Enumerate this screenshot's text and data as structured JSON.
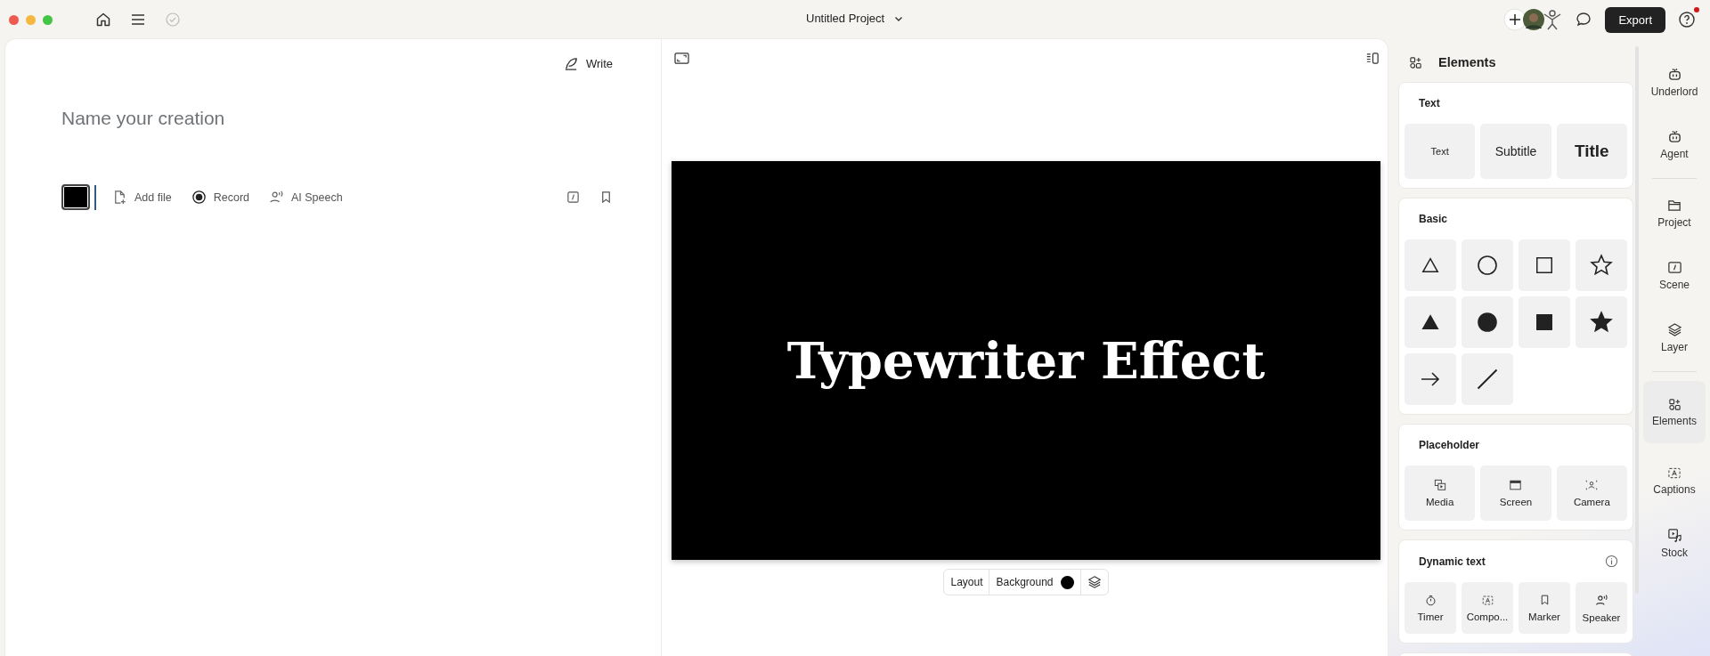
{
  "window": {
    "title": "Untitled Project"
  },
  "toolbar": {
    "export": "Export",
    "help_alert": true
  },
  "editor": {
    "write_button": "Write",
    "title_placeholder": "Name your creation",
    "actions": [
      {
        "label": "Add file",
        "kind": "file"
      },
      {
        "label": "Record",
        "kind": "record"
      },
      {
        "label": "AI Speech",
        "kind": "speech"
      }
    ]
  },
  "canvas": {
    "headline": "Typewriter Effect",
    "layout_button": "Layout",
    "background_button": "Background"
  },
  "elements_panel": {
    "title": "Elements",
    "sections": [
      {
        "title": "Text",
        "info": false,
        "items": [
          {
            "label": "Text",
            "kind": "plain"
          },
          {
            "label": "Subtitle",
            "kind": "subtitle"
          },
          {
            "label": "Title",
            "kind": "title"
          }
        ]
      },
      {
        "title": "Basic",
        "info": false,
        "items": [
          {
            "kind": "triangle",
            "filled": false
          },
          {
            "kind": "circle",
            "filled": false
          },
          {
            "kind": "square",
            "filled": false
          },
          {
            "kind": "star",
            "filled": false
          },
          {
            "kind": "triangle",
            "filled": true
          },
          {
            "kind": "circle",
            "filled": true
          },
          {
            "kind": "square",
            "filled": true
          },
          {
            "kind": "star",
            "filled": true
          },
          {
            "kind": "arrow"
          },
          {
            "kind": "line"
          }
        ]
      },
      {
        "title": "Placeholder",
        "info": false,
        "items": [
          {
            "label": "Media",
            "kind": "media"
          },
          {
            "label": "Screen",
            "kind": "screen"
          },
          {
            "label": "Camera",
            "kind": "camera"
          }
        ]
      },
      {
        "title": "Dynamic text",
        "info": true,
        "items": [
          {
            "label": "Timer",
            "kind": "timer"
          },
          {
            "label": "Compo...",
            "kind": "captions"
          },
          {
            "label": "Marker",
            "kind": "marker"
          },
          {
            "label": "Speaker",
            "kind": "speaker"
          }
        ]
      }
    ]
  },
  "rail": [
    {
      "items": [
        {
          "label": "Underlord",
          "kind": "robot",
          "selected": false
        },
        {
          "label": "Agent",
          "kind": "robot",
          "selected": false
        }
      ]
    },
    {
      "items": [
        {
          "label": "Project",
          "kind": "folder",
          "selected": false
        },
        {
          "label": "Scene",
          "kind": "scene",
          "selected": false
        },
        {
          "label": "Layer",
          "kind": "layers",
          "selected": false
        }
      ]
    },
    {
      "items": [
        {
          "label": "Elements",
          "kind": "elements",
          "selected": true
        },
        {
          "label": "Captions",
          "kind": "captions",
          "selected": false
        },
        {
          "label": "Stock",
          "kind": "stock",
          "selected": false
        }
      ]
    }
  ]
}
